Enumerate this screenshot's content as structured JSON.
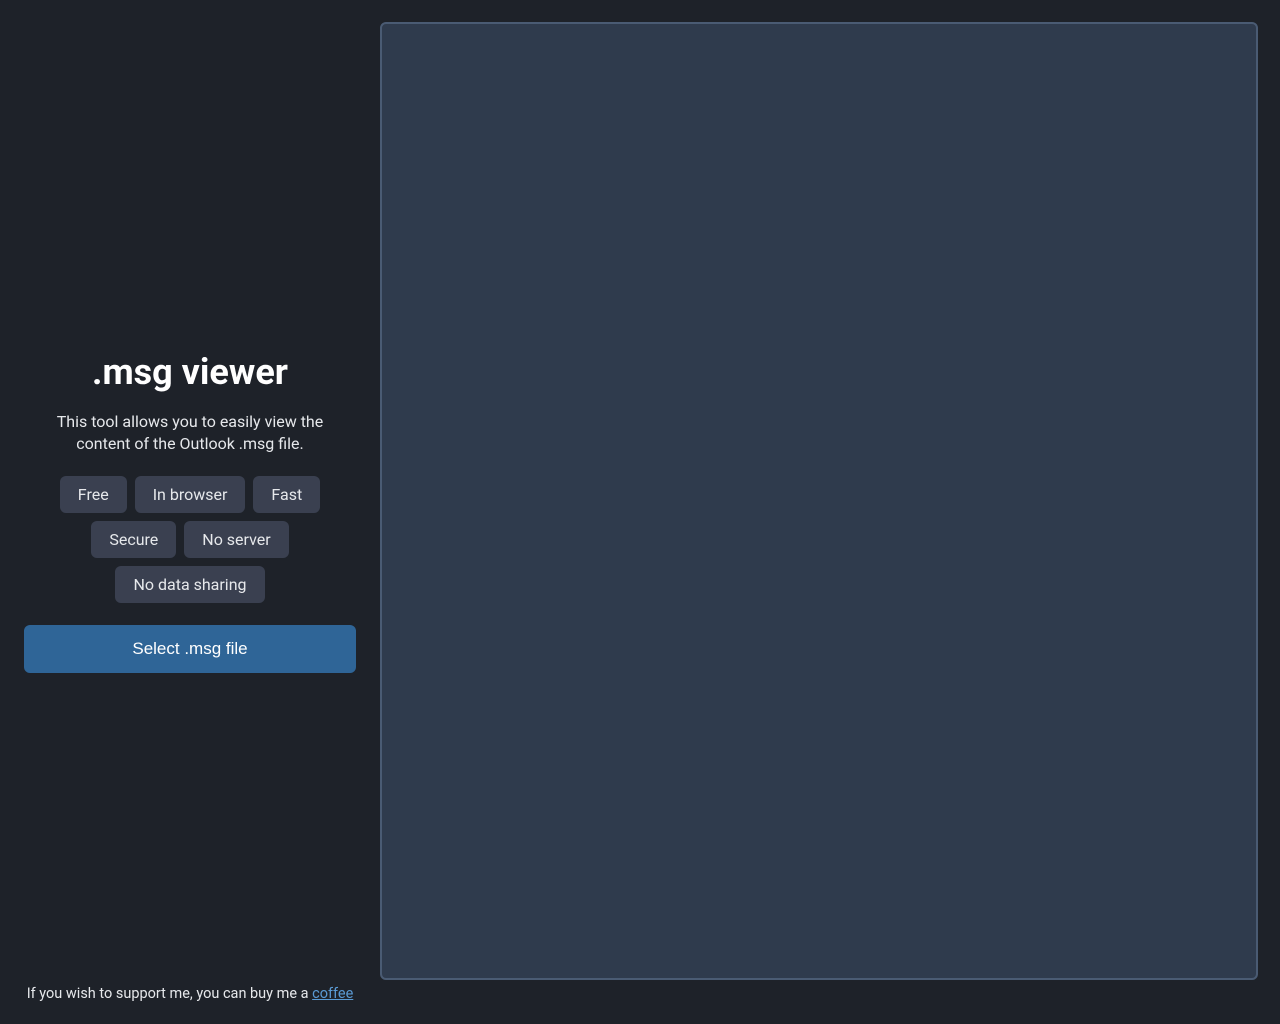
{
  "title": ".msg viewer",
  "subtitle": "This tool allows you to easily view the content of the Outlook .msg file.",
  "tags": [
    "Free",
    "In browser",
    "Fast",
    "Secure",
    "No server",
    "No data sharing"
  ],
  "select_button": "Select .msg file",
  "footer": {
    "text": "If you wish to support me, you can buy me a ",
    "link_text": "coffee"
  }
}
